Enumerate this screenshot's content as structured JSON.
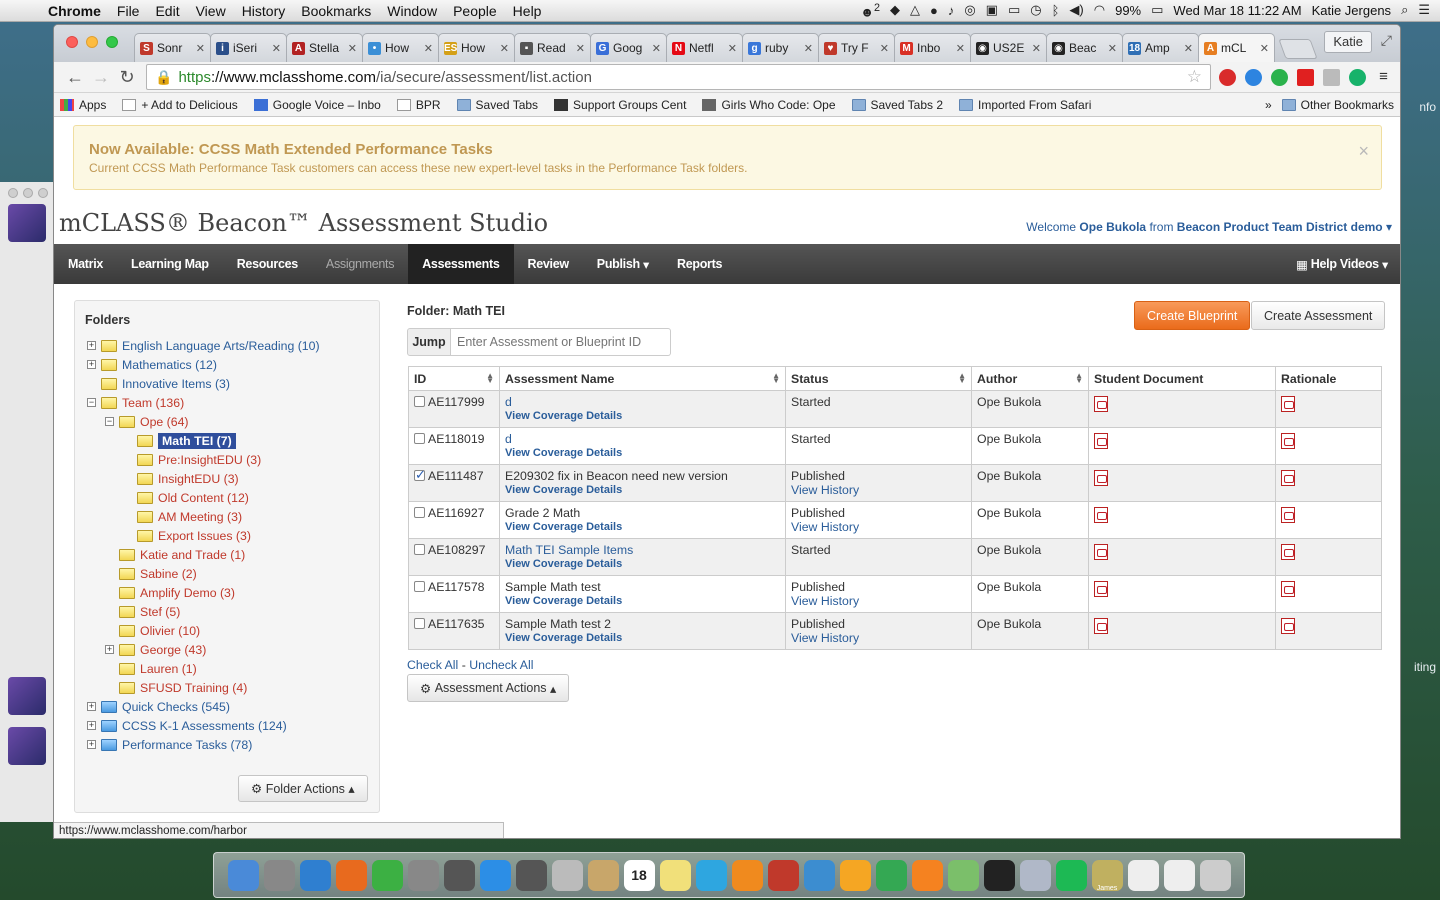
{
  "menubar": {
    "apple": "",
    "app": "Chrome",
    "items": [
      "File",
      "Edit",
      "View",
      "History",
      "Bookmarks",
      "Window",
      "People",
      "Help"
    ],
    "badge": "2",
    "battery": "99%",
    "clock": "Wed Mar 18  11:22 AM",
    "user": "Katie Jergens"
  },
  "browser": {
    "tabs": [
      {
        "label": "Sonr",
        "color": "#c0392b",
        "glyph": "S"
      },
      {
        "label": "iSeri",
        "color": "#2b4f8a",
        "glyph": "i"
      },
      {
        "label": "Stella",
        "color": "#b22222",
        "glyph": "A"
      },
      {
        "label": "How",
        "color": "#3b8fd6",
        "glyph": "•"
      },
      {
        "label": "How",
        "color": "#d4a017",
        "glyph": "ES"
      },
      {
        "label": "Read",
        "color": "#555",
        "glyph": "▪"
      },
      {
        "label": "Goog",
        "color": "#3a6fd8",
        "glyph": "G"
      },
      {
        "label": "Netfl",
        "color": "#e50914",
        "glyph": "N"
      },
      {
        "label": "ruby",
        "color": "#3a77d9",
        "glyph": "g"
      },
      {
        "label": "Try F",
        "color": "#c0392b",
        "glyph": "♥"
      },
      {
        "label": "Inbo",
        "color": "#d93025",
        "glyph": "M"
      },
      {
        "label": "US2E",
        "color": "#222",
        "glyph": "◉"
      },
      {
        "label": "Beac",
        "color": "#222",
        "glyph": "◉"
      },
      {
        "label": "Amp",
        "color": "#2f6fb5",
        "glyph": "18"
      },
      {
        "label": "mCL",
        "color": "#e67e22",
        "glyph": "A"
      }
    ],
    "active_tab_index": 14,
    "profile": "Katie",
    "url_scheme": "https",
    "url_host": "://www.mclasshome.com",
    "url_path": "/ia/secure/assessment/list.action",
    "bookmarks": [
      "Apps",
      "+ Add to Delicious",
      "Google Voice – Inbo",
      "BPR",
      "Saved Tabs",
      "Support Groups Cent",
      "Girls Who Code: Ope",
      "Saved Tabs 2",
      "Imported From Safari"
    ],
    "bookmarks_more": "»",
    "other_bookmarks": "Other Bookmarks",
    "status_url": "https://www.mclasshome.com/harbor"
  },
  "alert": {
    "title": "Now Available: CCSS Math Extended Performance Tasks",
    "text": "Current CCSS Math Performance Task customers can access these new expert-level tasks in the Performance Task folders.",
    "close": "×"
  },
  "brand": "mCLASS® Beacon™ Assessment Studio",
  "welcome": {
    "prefix": "Welcome",
    "user": "Ope Bukola",
    "from": "from",
    "district": "Beacon Product Team District demo"
  },
  "nav": {
    "items": [
      "Matrix",
      "Learning Map",
      "Resources",
      "Assignments",
      "Assessments",
      "Review",
      "Publish",
      "Reports"
    ],
    "active": "Assessments",
    "disabled": "Assignments",
    "help": "Help Videos"
  },
  "sidebar": {
    "title": "Folders",
    "tree": [
      {
        "label": "English Language Arts/Reading (10)",
        "depth": 0,
        "toggle": "+",
        "color": "blue",
        "icon": "yellow"
      },
      {
        "label": "Mathematics (12)",
        "depth": 0,
        "toggle": "+",
        "color": "blue",
        "icon": "yellow"
      },
      {
        "label": "Innovative Items (3)",
        "depth": 0,
        "toggle": "",
        "color": "blue",
        "icon": "yellow"
      },
      {
        "label": "Team (136)",
        "depth": 0,
        "toggle": "−",
        "color": "red",
        "icon": "yellow"
      },
      {
        "label": "Ope (64)",
        "depth": 1,
        "toggle": "−",
        "color": "red",
        "icon": "yellow"
      },
      {
        "label": "Math TEI (7)",
        "depth": 2,
        "toggle": "",
        "color": "sel",
        "icon": "yellow"
      },
      {
        "label": "Pre:InsightEDU (3)",
        "depth": 2,
        "toggle": "",
        "color": "red",
        "icon": "yellow"
      },
      {
        "label": "InsightEDU (3)",
        "depth": 2,
        "toggle": "",
        "color": "red",
        "icon": "yellow"
      },
      {
        "label": "Old Content (12)",
        "depth": 2,
        "toggle": "",
        "color": "red",
        "icon": "yellow"
      },
      {
        "label": "AM Meeting (3)",
        "depth": 2,
        "toggle": "",
        "color": "red",
        "icon": "yellow"
      },
      {
        "label": "Export Issues (3)",
        "depth": 2,
        "toggle": "",
        "color": "red",
        "icon": "yellow"
      },
      {
        "label": "Katie and Trade (1)",
        "depth": 1,
        "toggle": "",
        "color": "red",
        "icon": "yellow"
      },
      {
        "label": "Sabine (2)",
        "depth": 1,
        "toggle": "",
        "color": "red",
        "icon": "yellow"
      },
      {
        "label": "Amplify Demo (3)",
        "depth": 1,
        "toggle": "",
        "color": "red",
        "icon": "yellow"
      },
      {
        "label": "Stef (5)",
        "depth": 1,
        "toggle": "",
        "color": "red",
        "icon": "yellow"
      },
      {
        "label": "Olivier (10)",
        "depth": 1,
        "toggle": "",
        "color": "red",
        "icon": "yellow"
      },
      {
        "label": "George (43)",
        "depth": 1,
        "toggle": "+",
        "color": "red",
        "icon": "yellow"
      },
      {
        "label": "Lauren (1)",
        "depth": 1,
        "toggle": "",
        "color": "red",
        "icon": "yellow"
      },
      {
        "label": "SFUSD Training (4)",
        "depth": 1,
        "toggle": "",
        "color": "red",
        "icon": "yellow"
      },
      {
        "label": "Quick Checks (545)",
        "depth": 0,
        "toggle": "+",
        "color": "blue",
        "icon": "blue"
      },
      {
        "label": "CCSS K-1 Assessments (124)",
        "depth": 0,
        "toggle": "+",
        "color": "blue",
        "icon": "blue"
      },
      {
        "label": "Performance Tasks (78)",
        "depth": 0,
        "toggle": "+",
        "color": "blue",
        "icon": "blue"
      }
    ],
    "folder_actions": "Folder Actions"
  },
  "main": {
    "folder_label": "Folder: Math TEI",
    "create_blueprint": "Create Blueprint",
    "create_assessment": "Create Assessment",
    "jump_label": "Jump",
    "jump_placeholder": "Enter Assessment or Blueprint ID",
    "columns": [
      "ID",
      "Assessment Name",
      "Status",
      "Author",
      "Student Document",
      "Rationale"
    ],
    "rows": [
      {
        "id": "AE117999",
        "name": "d",
        "name_link": true,
        "sub": "View Coverage Details",
        "status": "Started",
        "status_sub": "",
        "author": "Ope Bukola",
        "checked": false
      },
      {
        "id": "AE118019",
        "name": "d",
        "name_link": true,
        "sub": "View Coverage Details",
        "status": "Started",
        "status_sub": "",
        "author": "Ope Bukola",
        "checked": false
      },
      {
        "id": "AE111487",
        "name": "E209302 fix in Beacon need new version",
        "name_link": false,
        "sub": "View Coverage Details",
        "status": "Published",
        "status_sub": "View History",
        "author": "Ope Bukola",
        "checked": true
      },
      {
        "id": "AE116927",
        "name": "Grade 2 Math",
        "name_link": false,
        "sub": "View Coverage Details",
        "status": "Published",
        "status_sub": "View History",
        "author": "Ope Bukola",
        "checked": false
      },
      {
        "id": "AE108297",
        "name": "Math TEI Sample Items",
        "name_link": true,
        "sub": "View Coverage Details",
        "status": "Started",
        "status_sub": "",
        "author": "Ope Bukola",
        "checked": false
      },
      {
        "id": "AE117578",
        "name": "Sample Math test",
        "name_link": false,
        "sub": "View Coverage Details",
        "status": "Published",
        "status_sub": "View History",
        "author": "Ope Bukola",
        "checked": false
      },
      {
        "id": "AE117635",
        "name": "Sample Math test 2",
        "name_link": false,
        "sub": "View Coverage Details",
        "status": "Published",
        "status_sub": "View History",
        "author": "Ope Bukola",
        "checked": false
      }
    ],
    "check_all": "Check All",
    "separator": "-",
    "uncheck_all": "Uncheck All",
    "assessment_actions": "Assessment Actions"
  },
  "desktop": {
    "right_labels": [
      "nfo",
      "iting"
    ]
  },
  "dock": {
    "icons": [
      "finder",
      "launchpad",
      "safari",
      "firefox",
      "chrome",
      "system-prefs",
      "photo-app",
      "app-store",
      "facetime",
      "calculator",
      "contacts",
      "calendar",
      "notes",
      "itunes",
      "ibooks",
      "photo-booth",
      "preview",
      "sunflower",
      "evernote",
      "sublime",
      "maps",
      "terminal",
      "photos",
      "spotify",
      "messenger",
      "document",
      "document",
      "trash"
    ],
    "calendar_date": "18",
    "user_tag": "James Cu"
  }
}
